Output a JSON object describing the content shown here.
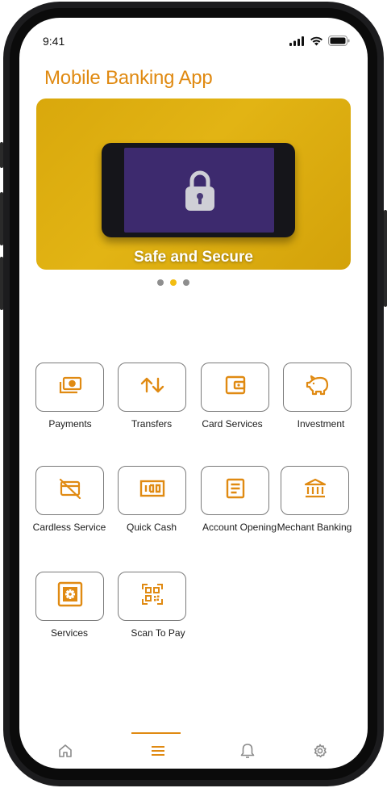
{
  "status_bar": {
    "time": "9:41"
  },
  "app": {
    "title": "Mobile Banking App"
  },
  "banner": {
    "caption": "Safe and Secure",
    "slides_total": 3,
    "active_slide": 2
  },
  "services": [
    {
      "label": "Payments",
      "icon": "money-icon"
    },
    {
      "label": "Transfers",
      "icon": "transfer-arrows-icon"
    },
    {
      "label": "Card Services",
      "icon": "wallet-icon"
    },
    {
      "label": "Investment",
      "icon": "piggy-bank-icon"
    },
    {
      "label": "Cardless Service",
      "icon": "card-off-icon"
    },
    {
      "label": "Quick Cash",
      "icon": "cash-icon"
    },
    {
      "label": "Account Opening",
      "icon": "document-icon"
    },
    {
      "label": "Mechant Banking",
      "icon": "bank-icon"
    },
    {
      "label": "Services",
      "icon": "settings-box-icon"
    },
    {
      "label": "Scan To Pay",
      "icon": "qr-code-icon"
    }
  ],
  "bottom_nav": [
    {
      "icon": "home-icon"
    },
    {
      "icon": "menu-icon",
      "active": true
    },
    {
      "icon": "bell-icon"
    },
    {
      "icon": "gear-icon"
    }
  ],
  "colors": {
    "accent": "#e08a12",
    "banner_yellow": "#dcab0f",
    "active_dot": "#f2bd12",
    "inactive_dot": "#8e8e8e",
    "tile_border": "#7a7a7a"
  }
}
